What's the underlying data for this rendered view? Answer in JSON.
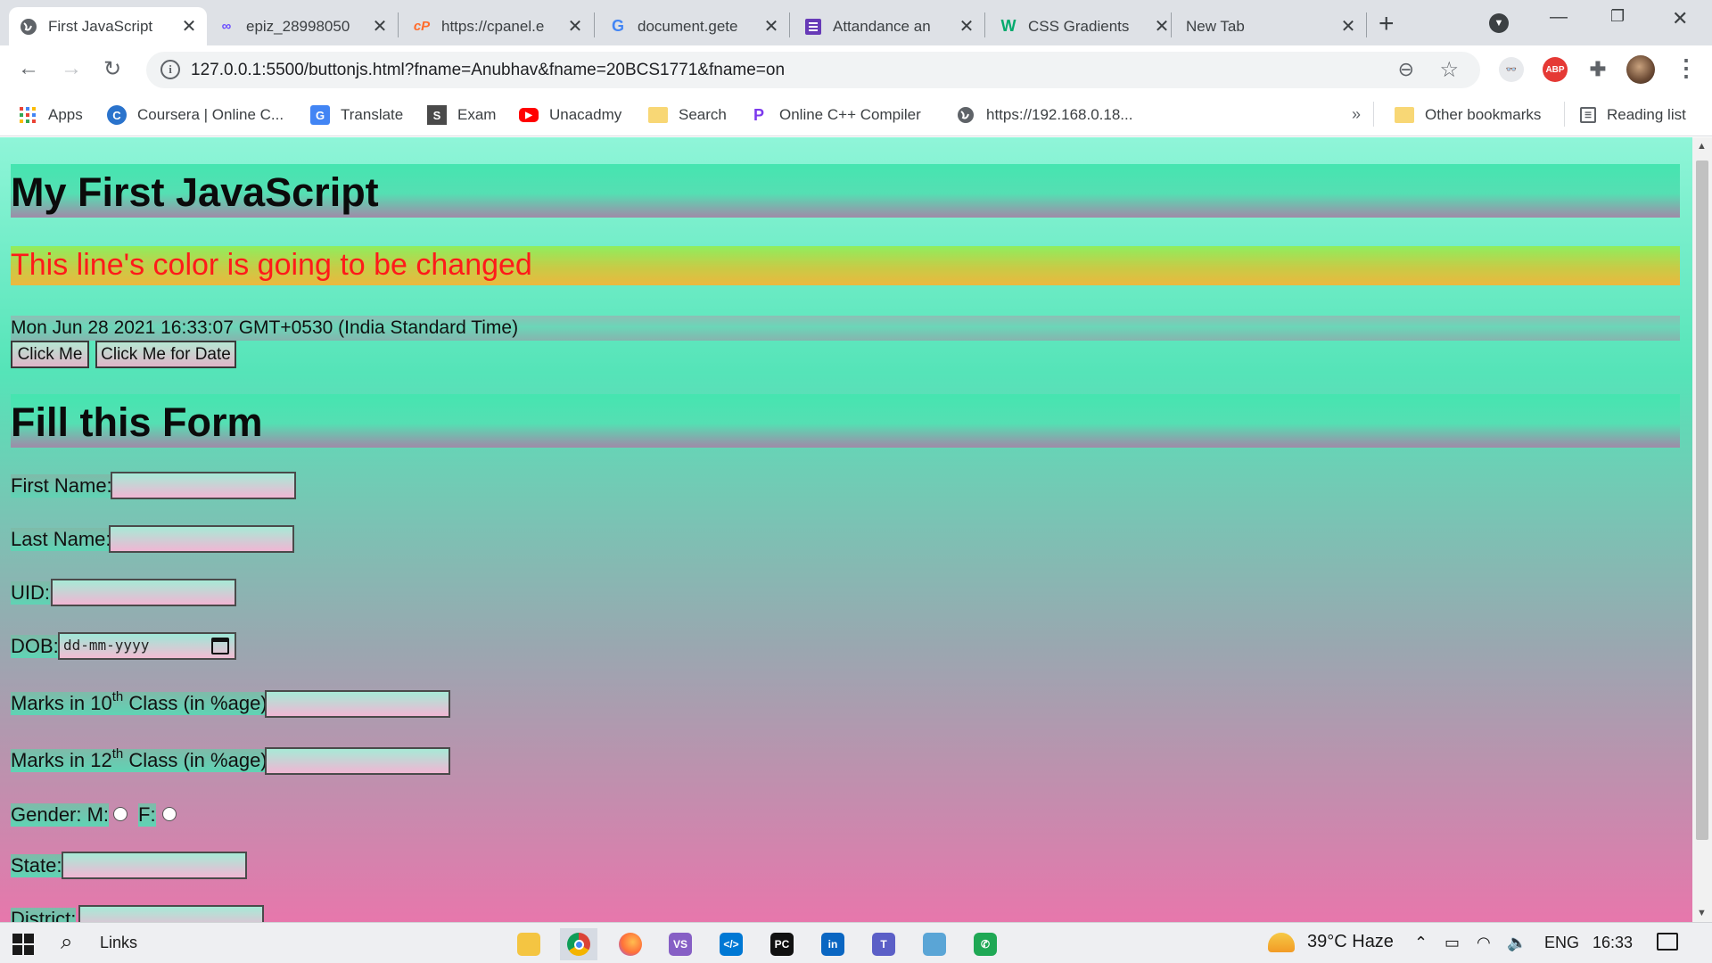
{
  "browser": {
    "tabs": [
      {
        "title": "First JavaScript",
        "icon": "globe-icon",
        "active": true
      },
      {
        "title": "epiz_28998050",
        "icon": "infinity-icon"
      },
      {
        "title": "https://cpanel.e",
        "icon": "cpanel-icon"
      },
      {
        "title": "document.gete",
        "icon": "google-icon"
      },
      {
        "title": "Attandance an",
        "icon": "forms-icon"
      },
      {
        "title": "CSS Gradients",
        "icon": "w3schools-icon"
      },
      {
        "title": "New Tab",
        "icon": "none"
      }
    ],
    "url": "127.0.0.1:5500/buttonjs.html?fname=Anubhav&fname=20BCS1771&fname=on",
    "bookmarks": [
      {
        "label": "Apps",
        "icon": "apps-grid-icon"
      },
      {
        "label": "Coursera | Online C...",
        "icon": "coursera-icon"
      },
      {
        "label": "Translate",
        "icon": "translate-icon"
      },
      {
        "label": "Exam",
        "icon": "exam-icon"
      },
      {
        "label": "Unacadmy",
        "icon": "youtube-icon"
      },
      {
        "label": "Search",
        "icon": "folder-icon"
      },
      {
        "label": "Online C++ Compiler",
        "icon": "compiler-icon"
      },
      {
        "label": "https://192.168.0.18...",
        "icon": "globe-icon"
      }
    ],
    "other_bookmarks": "Other bookmarks",
    "reading_list": "Reading list",
    "extensions": [
      {
        "name": "owl-extension-icon",
        "color": "#e8eaed"
      },
      {
        "name": "adblock-icon",
        "color": "#e53935",
        "label": "ABP"
      },
      {
        "name": "puzzle-icon"
      },
      {
        "name": "profile-avatar"
      }
    ]
  },
  "page": {
    "heading1": "My First JavaScript",
    "colored_line": "This line's color is going to be changed",
    "date_text": "Mon Jun 28 2021 16:33:07 GMT+0530 (India Standard Time)",
    "buttons": {
      "click_me": "Click Me",
      "click_date": "Click Me for Date"
    },
    "heading2": "Fill this Form",
    "form": {
      "first_name": "First Name:",
      "last_name": "Last Name:",
      "uid": "UID:",
      "dob": "DOB:",
      "dob_placeholder": "dd-mm-yyyy",
      "marks10_pre": "Marks in 10",
      "marks10_sup": "th",
      "marks10_post": " Class (in %age):",
      "marks12_pre": "Marks in 12",
      "marks12_sup": "th",
      "marks12_post": " Class (in %age):",
      "gender": "Gender: M:",
      "gender_f": "F:",
      "state": "State:",
      "district": "District:"
    }
  },
  "taskbar": {
    "search_text": "Links",
    "weather": "39°C  Haze",
    "language": "ENG",
    "time": "16:33",
    "apps": [
      {
        "name": "file-explorer-icon",
        "color": "#f4c542"
      },
      {
        "name": "chrome-icon",
        "color": "#db4437",
        "active": true
      },
      {
        "name": "firefox-icon",
        "color": "#ff7139"
      },
      {
        "name": "visual-studio-icon",
        "color": "#865fc5"
      },
      {
        "name": "vscode-icon",
        "color": "#0078d4"
      },
      {
        "name": "pycharm-icon",
        "color": "#111111"
      },
      {
        "name": "linkedin-icon",
        "color": "#0a66c2"
      },
      {
        "name": "teams-icon",
        "color": "#5b5fc7"
      },
      {
        "name": "notepad-icon",
        "color": "#5aa5d6"
      },
      {
        "name": "whatsapp-icon",
        "color": "#1fa855"
      }
    ]
  }
}
